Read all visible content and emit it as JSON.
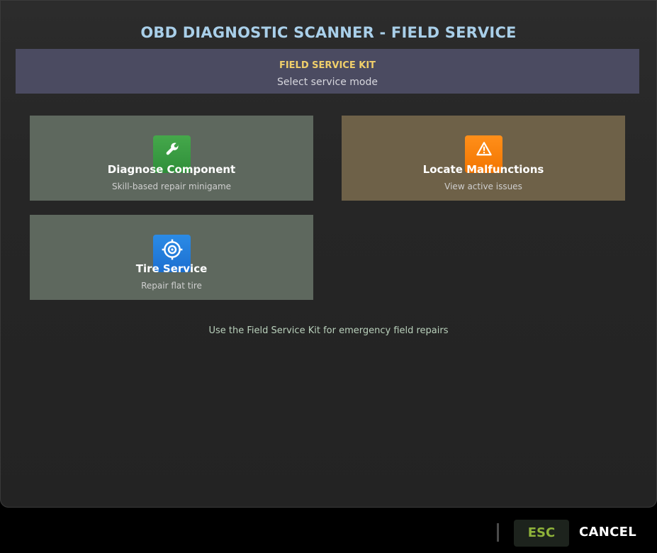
{
  "header": {
    "title": "OBD DIAGNOSTIC SCANNER - FIELD SERVICE"
  },
  "banner": {
    "heading": "FIELD SERVICE KIT",
    "subtitle": "Select service mode"
  },
  "cards": [
    {
      "title": "Diagnose Component",
      "subtitle": "Skill-based repair minigame",
      "icon": "wrench-icon",
      "icon_color": "#3a9d44",
      "card_color": "#5e685e"
    },
    {
      "title": "Locate Malfunctions",
      "subtitle": "View active issues",
      "icon": "warning-icon",
      "icon_color": "#f58300",
      "card_color": "#6e6148"
    },
    {
      "title": "Tire Service",
      "subtitle": "Repair flat tire",
      "icon": "target-icon",
      "icon_color": "#2580dc",
      "card_color": "#5e685e"
    }
  ],
  "footer": {
    "note": "Use the Field Service Kit for emergency field repairs"
  },
  "controls": {
    "esc_key": "ESC",
    "cancel_label": "CANCEL"
  },
  "colors": {
    "title": "#a9cfe9",
    "banner_bg": "#4b4b61",
    "banner_heading": "#f0cf6a",
    "esc_key_text": "#8fb33a"
  }
}
